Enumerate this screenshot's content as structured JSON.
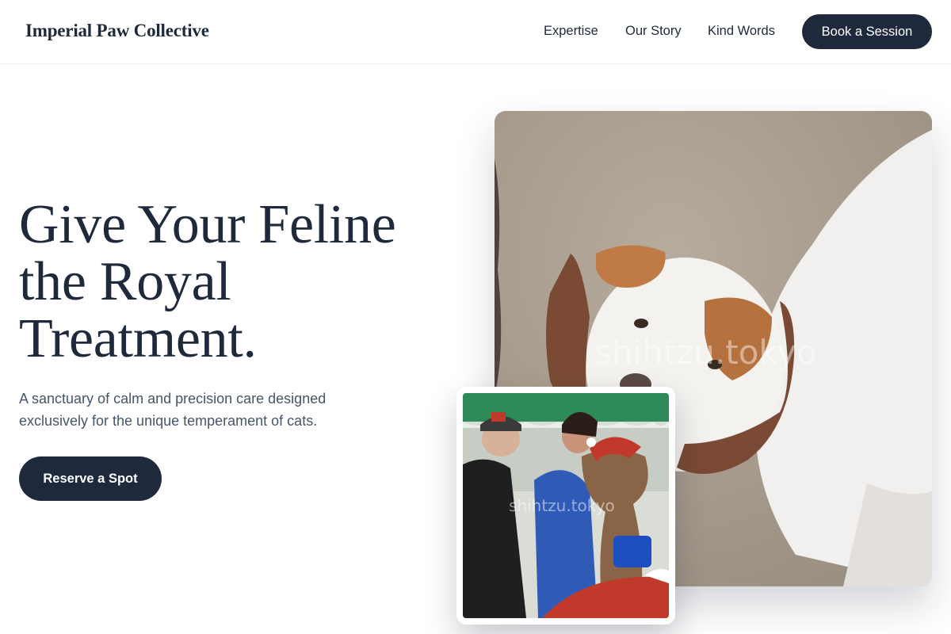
{
  "header": {
    "brand": "Imperial Paw Collective",
    "nav": [
      "Expertise",
      "Our Story",
      "Kind Words"
    ],
    "cta": "Book a Session"
  },
  "hero": {
    "headline": "Give Your Feline the Royal Treatment.",
    "subtext": "A sanctuary of calm and precision care designed exclusively for the unique temperament of cats.",
    "cta": "Reserve a Spot"
  },
  "images": {
    "main_watermark": "shihtzu.tokyo",
    "small_watermark": "shihtzu.tokyo"
  },
  "colors": {
    "primary": "#1e293b",
    "body_text": "#475569",
    "background": "#ffffff"
  }
}
